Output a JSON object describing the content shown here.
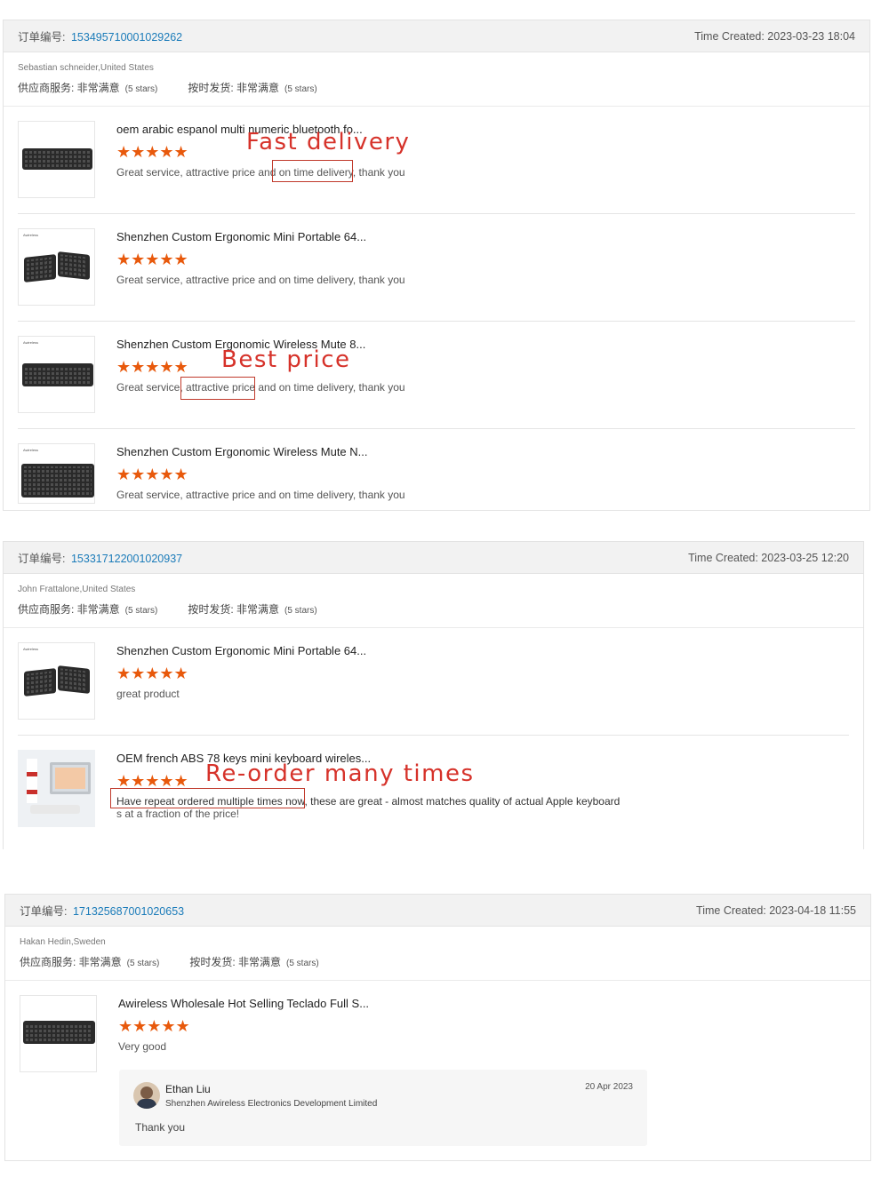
{
  "orders": [
    {
      "order_label": "订单编号:",
      "order_number": "153495710001029262",
      "time_created": "Time Created: 2023-03-23 18:04",
      "buyer": "Sebastian schneider,United States",
      "supplier_service_label": "供应商服务: 非常满意",
      "supplier_service_stars": "(5 stars)",
      "ontime_label": "按时发货: 非常满意",
      "ontime_stars": "(5 stars)",
      "items": [
        {
          "title": "oem arabic espanol multi numeric bluetooth fo...",
          "stars": "★★★★★",
          "review": "Great service, attractive price and on time delivery, thank you",
          "rating": 5
        },
        {
          "title": "Shenzhen Custom Ergonomic Mini Portable 64...",
          "stars": "★★★★★",
          "review": "Great service, attractive price and on time delivery, thank you",
          "rating": 5
        },
        {
          "title": "Shenzhen Custom Ergonomic Wireless Mute 8...",
          "stars": "★★★★★",
          "review": "Great service, attractive price and on time delivery, thank you",
          "rating": 5
        },
        {
          "title": "Shenzhen Custom Ergonomic Wireless Mute N...",
          "stars": "★★★★★",
          "review": "Great service, attractive price and on time delivery, thank you",
          "rating": 5
        }
      ]
    },
    {
      "order_label": "订单编号:",
      "order_number": "153317122001020937",
      "time_created": "Time Created: 2023-03-25 12:20",
      "buyer": "John Frattalone,United States",
      "supplier_service_label": "供应商服务: 非常满意",
      "supplier_service_stars": "(5 stars)",
      "ontime_label": "按时发货: 非常满意",
      "ontime_stars": "(5 stars)",
      "items": [
        {
          "title": "Shenzhen Custom Ergonomic Mini Portable 64...",
          "stars": "★★★★★",
          "review": "great product",
          "rating": 5
        },
        {
          "title": "OEM french ABS 78 keys mini keyboard wireles...",
          "stars": "★★★★★",
          "review_line1": "Have repeat ordered multiple times now, these are great - almost matches quality of actual Apple keyboard",
          "review_line2": "s at a fraction of the price!",
          "rating": 5
        }
      ]
    },
    {
      "order_label": "订单编号:",
      "order_number": "171325687001020653",
      "time_created": "Time Created: 2023-04-18 11:55",
      "buyer": "Hakan Hedin,Sweden",
      "supplier_service_label": "供应商服务: 非常满意",
      "supplier_service_stars": "(5 stars)",
      "ontime_label": "按时发货: 非常满意",
      "ontime_stars": "(5 stars)",
      "items": [
        {
          "title": "Awireless Wholesale Hot Selling Teclado Full S...",
          "stars": "★★★★★",
          "review": "Very good",
          "rating": 5
        }
      ],
      "reply": {
        "name": "Ethan Liu",
        "company": "Shenzhen Awireless Electronics Development Limited",
        "date": "20 Apr 2023",
        "text": "Thank you"
      }
    }
  ],
  "callouts": {
    "fast_delivery": "Fast delivery",
    "best_price": "Best price",
    "reorder": "Re-order many times"
  },
  "brand_mark": "Awireless",
  "colors": {
    "order_number": "#1a7bb9",
    "stars": "#e8590c",
    "callout": "#d6322a"
  }
}
